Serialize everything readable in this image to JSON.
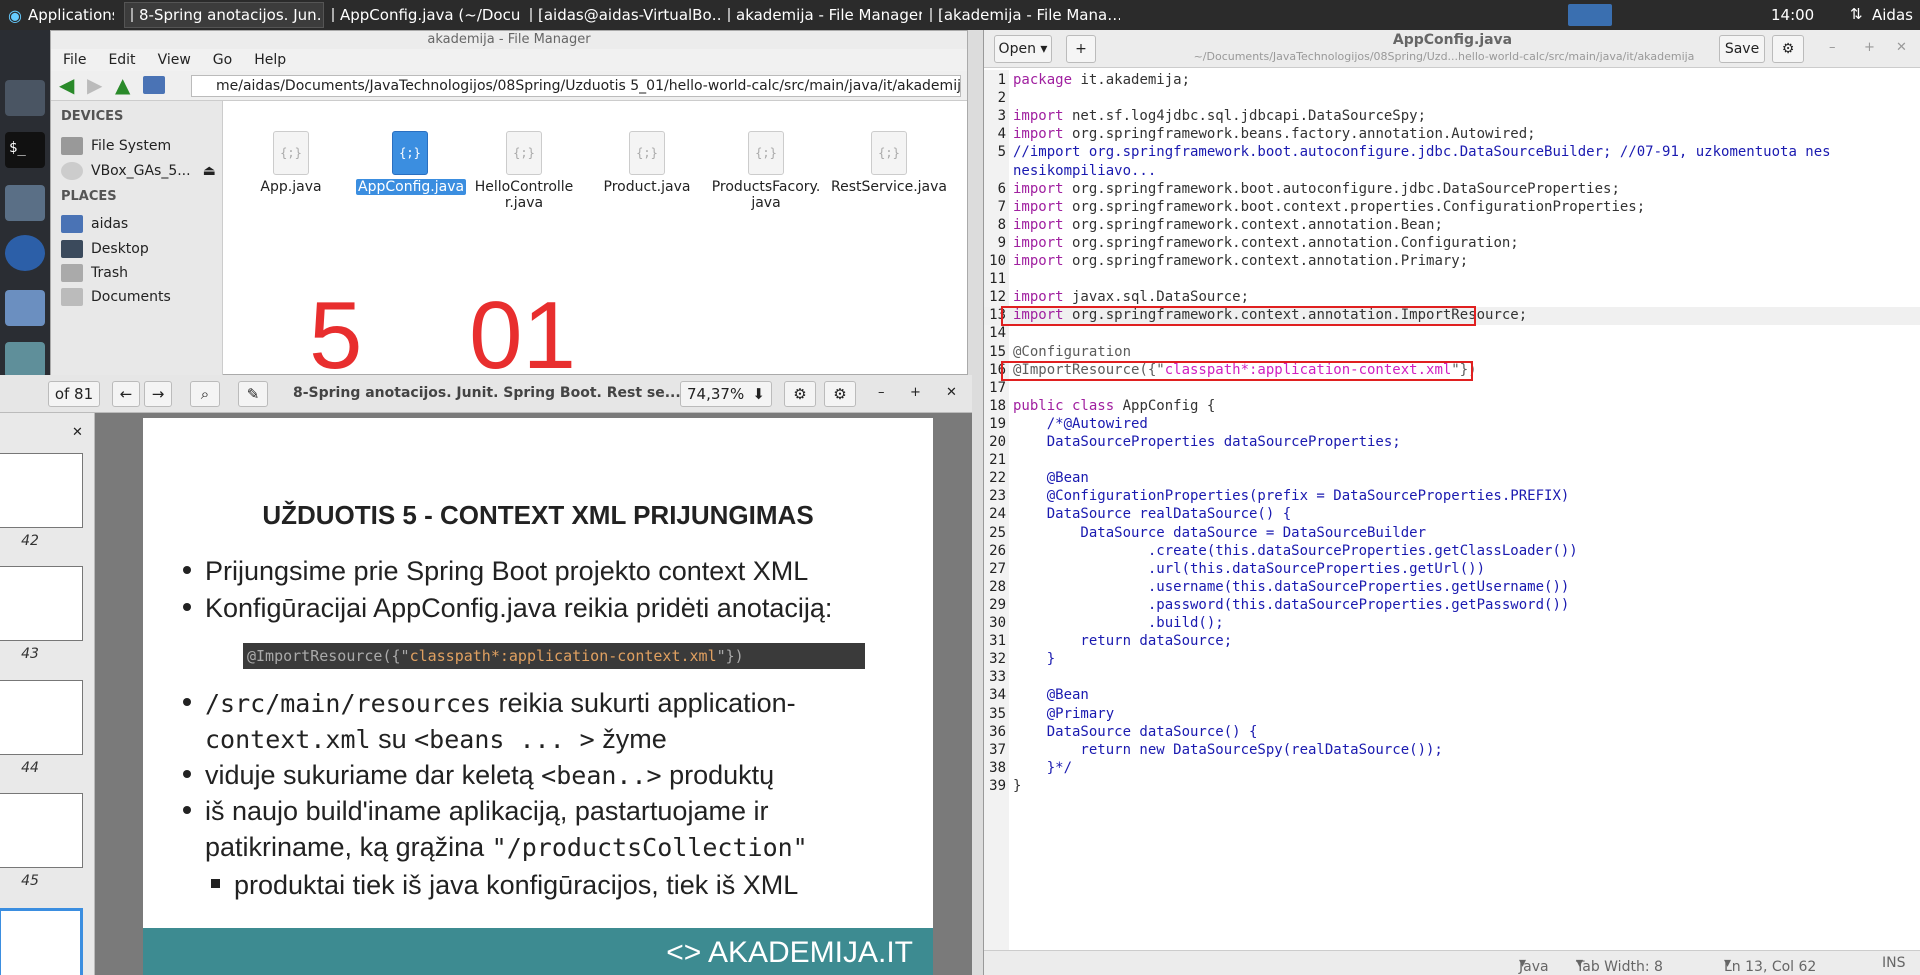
{
  "taskbar": {
    "apps_label": "Applications",
    "tasks": [
      "8-Spring anotacijos. Jun…",
      "AppConfig.java (~/Docu…",
      "[aidas@aidas-VirtualBo…",
      "akademija - File Manager",
      "[akademija - File Mana…"
    ],
    "clock": "14:00",
    "user": "Aidas"
  },
  "file_manager": {
    "title": "akademija - File Manager",
    "menu": [
      "File",
      "Edit",
      "View",
      "Go",
      "Help"
    ],
    "path": "me/aidas/Documents/JavaTechnologijos/08Spring/Uzduotis 5_01/hello-world-calc/src/main/java/it/akademija/",
    "devices_header": "DEVICES",
    "devices": [
      "File System",
      "VBox_GAs_5..."
    ],
    "places_header": "PLACES",
    "places": [
      "aidas",
      "Desktop",
      "Trash",
      "Documents"
    ],
    "files": [
      {
        "name": "App.java",
        "selected": false
      },
      {
        "name": "AppConfig.java",
        "selected": true
      },
      {
        "name": "HelloController.java",
        "selected": false
      },
      {
        "name": "Product.java",
        "selected": false
      },
      {
        "name": "ProductsFacory.java",
        "selected": false
      },
      {
        "name": "RestService.java",
        "selected": false
      }
    ],
    "icon_glyph": "{;}",
    "overlay_text": "5__01"
  },
  "pdf": {
    "page_of": "of 81",
    "title": "8-Spring anotacijos. Junit. Spring Boot. Rest se...",
    "zoom": "74,37%",
    "thumb_numbers": [
      "42",
      "43",
      "44",
      "45"
    ],
    "slide": {
      "heading": "UŽDUOTIS 5 - CONTEXT XML PRIJUNGIMAS",
      "b1": "Prijungsime prie Spring Boot projekto context XML",
      "b2": "Konfigūracijai AppConfig.java reikia pridėti anotaciją:",
      "code_pre": "@ImportResource({\"",
      "code_str": "classpath*:application-context.xml",
      "code_post": "\"})",
      "b3a": "/src/main/resources",
      "b3b": " reikia sukurti ",
      "b3c": "application-",
      "b3d": "context.xml",
      "b3e": " su ",
      "b3f": "<beans ... >",
      "b3g": " žyme",
      "b4a": "viduje sukuriame dar keletą ",
      "b4b": "<bean..>",
      "b4c": " produktų",
      "b5a": "iš naujo build'iname aplikaciją, pastartuojame ir",
      "b5b": "patikriname, ką grąžina ",
      "b5c": "\"/productsCollection\"",
      "b6": "produktai tiek iš java konfigūracijos, tiek iš XML",
      "footer_logo": "<> AKADEMIJA.IT"
    }
  },
  "editor": {
    "open_label": "Open",
    "title": "AppConfig.java",
    "subtitle": "~/Documents/JavaTechnologijos/08Spring/Uzd...hello-world-calc/src/main/java/it/akademija",
    "save_label": "Save",
    "lines": [
      "package it.akademija;",
      "",
      "import net.sf.log4jdbc.sql.jdbcapi.DataSourceSpy;",
      "import org.springframework.beans.factory.annotation.Autowired;",
      "//import org.springframework.boot.autoconfigure.jdbc.DataSourceBuilder; //07-91, uzkomentuota nes",
      "nesikompiliavo...",
      "import org.springframework.boot.autoconfigure.jdbc.DataSourceProperties;",
      "import org.springframework.boot.context.properties.ConfigurationProperties;",
      "import org.springframework.context.annotation.Bean;",
      "import org.springframework.context.annotation.Configuration;",
      "import org.springframework.context.annotation.Primary;",
      "",
      "import javax.sql.DataSource;",
      "import org.springframework.context.annotation.ImportResource;",
      "",
      "@Configuration",
      "@ImportResource({\"classpath*:application-context.xml\"})",
      "",
      "public class AppConfig {",
      "    /*@Autowired",
      "    DataSourceProperties dataSourceProperties;",
      "",
      "    @Bean",
      "    @ConfigurationProperties(prefix = DataSourceProperties.PREFIX)",
      "    DataSource realDataSource() {",
      "        DataSource dataSource = DataSourceBuilder",
      "                .create(this.dataSourceProperties.getClassLoader())",
      "                .url(this.dataSourceProperties.getUrl())",
      "                .username(this.dataSourceProperties.getUsername())",
      "                .password(this.dataSourceProperties.getPassword())",
      "                .build();",
      "        return dataSource;",
      "    }",
      "",
      "    @Bean",
      "    @Primary",
      "    DataSource dataSource() {",
      "        return new DataSourceSpy(realDataSource());",
      "    }*/",
      "}"
    ],
    "line_numbers": [
      "1",
      "2",
      "3",
      "4",
      "5",
      "",
      "6",
      "7",
      "8",
      "9",
      "10",
      "11",
      "12",
      "13",
      "14",
      "15",
      "16",
      "17",
      "18",
      "19",
      "20",
      "21",
      "22",
      "23",
      "24",
      "25",
      "26",
      "27",
      "28",
      "29",
      "30",
      "31",
      "32",
      "33",
      "34",
      "35",
      "36",
      "37",
      "38",
      "39"
    ],
    "status": {
      "language": "Java",
      "tab_width": "Tab Width: 8",
      "position": "Ln 13, Col 62",
      "mode": "INS"
    }
  }
}
